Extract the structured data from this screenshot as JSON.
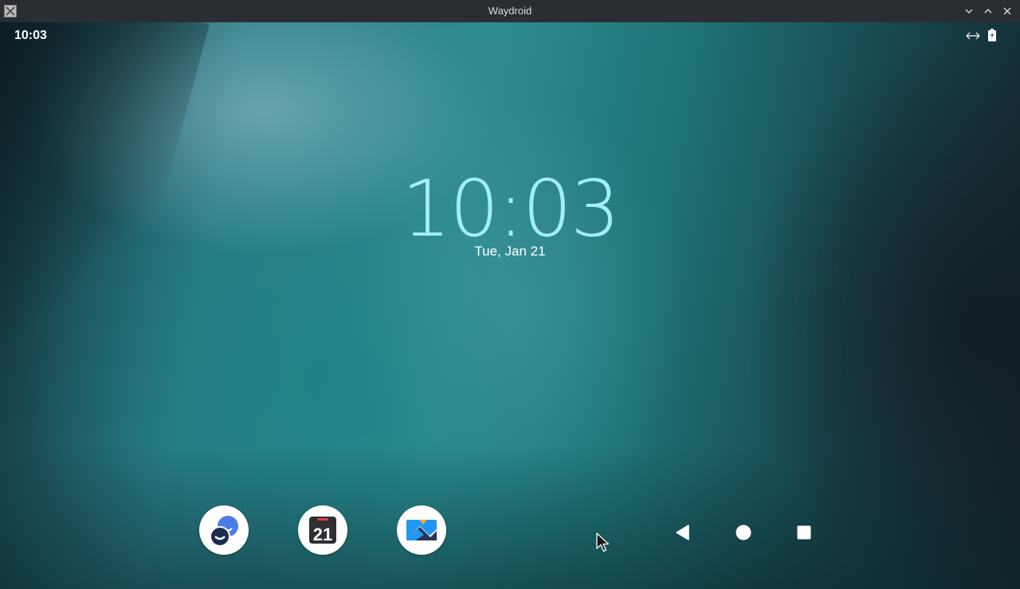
{
  "window": {
    "title": "Waydroid",
    "app_icon": "x-app-icon",
    "controls": [
      "minimize-chevron-down-icon",
      "maximize-chevron-up-icon",
      "close-icon"
    ]
  },
  "status_bar": {
    "time": "10:03",
    "icons": [
      "data-transfer-arrows-icon",
      "battery-charging-icon"
    ]
  },
  "lockscreen": {
    "clock": "10:03",
    "date": "Tue, Jan 21"
  },
  "dock": {
    "apps": [
      {
        "name": "messaging",
        "icon": "chat-bubbles-icon"
      },
      {
        "name": "calendar",
        "icon": "calendar-icon",
        "day": "21"
      },
      {
        "name": "gallery",
        "icon": "gallery-icon"
      }
    ]
  },
  "nav_bar": {
    "buttons": [
      "back-icon",
      "home-icon",
      "recents-icon"
    ]
  },
  "colors": {
    "clock": "#a4eef8",
    "titlebar": "#2a2e32",
    "calendar_accent": "#e53935",
    "gallery_blue": "#2196f3",
    "gallery_dark": "#1a2b4a",
    "gallery_sun": "#f4a83a",
    "chat_blue": "#4c7be8",
    "chat_dark": "#1c2e50"
  }
}
